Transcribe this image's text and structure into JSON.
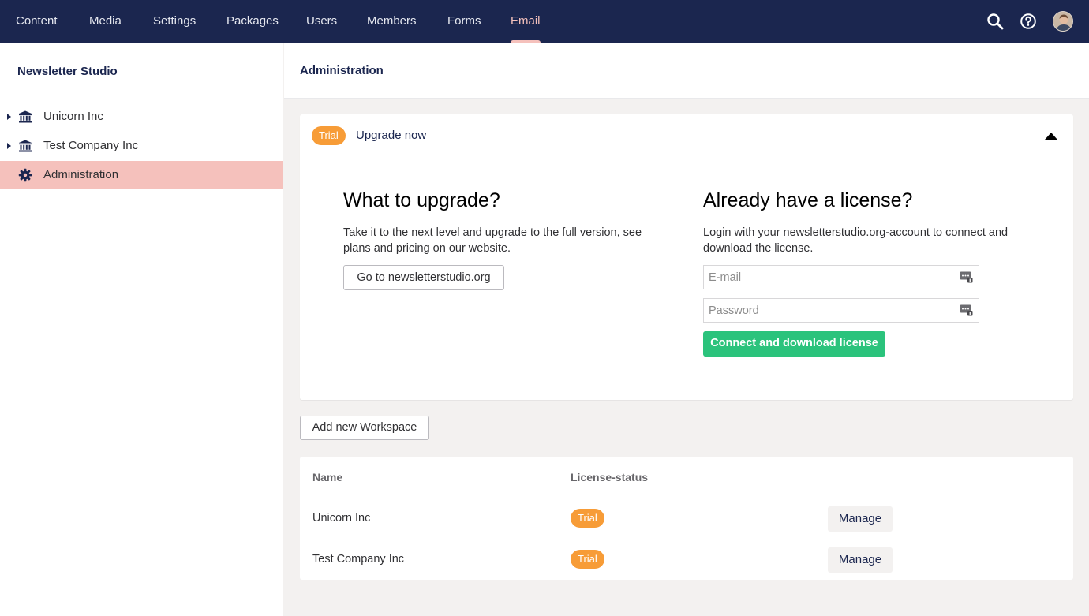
{
  "topnav": {
    "items": [
      {
        "label": "Content",
        "active": false
      },
      {
        "label": "Media",
        "active": false
      },
      {
        "label": "Settings",
        "active": false
      },
      {
        "label": "Packages",
        "active": false
      },
      {
        "label": "Users",
        "active": false
      },
      {
        "label": "Members",
        "active": false
      },
      {
        "label": "Forms",
        "active": false
      },
      {
        "label": "Email",
        "active": true
      }
    ],
    "icons": [
      "search-icon",
      "help-icon",
      "avatar"
    ]
  },
  "sidebar": {
    "title": "Newsletter Studio",
    "items": [
      {
        "label": "Unicorn Inc",
        "icon": "bank-icon",
        "expandable": true,
        "active": false
      },
      {
        "label": "Test Company Inc",
        "icon": "bank-icon",
        "expandable": true,
        "active": false
      },
      {
        "label": "Administration",
        "icon": "gear-icon",
        "expandable": false,
        "active": true
      }
    ]
  },
  "main": {
    "title": "Administration",
    "upgrade_panel": {
      "badge": "Trial",
      "label": "Upgrade now",
      "left": {
        "heading": "What to upgrade?",
        "text_line1": "Take it to the next level and upgrade to the full version, see",
        "text_line2": "plans and pricing on our website.",
        "button": "Go to newsletterstudio.org"
      },
      "right": {
        "heading": "Already have a license?",
        "text_line1": "Login with your newsletterstudio.org-account to connect and",
        "text_line2": "download the license.",
        "email_placeholder": "E-mail",
        "password_placeholder": "Password",
        "button": "Connect and download license"
      }
    },
    "add_workspace_button": "Add new Workspace",
    "table": {
      "headers": [
        "Name",
        "License-status"
      ],
      "rows": [
        {
          "name": "Unicorn Inc",
          "status": "Trial",
          "action": "Manage"
        },
        {
          "name": "Test Company Inc",
          "status": "Trial",
          "action": "Manage"
        }
      ]
    }
  },
  "colors": {
    "nav_bg": "#1b264f",
    "accent_pink": "#f5c1bc",
    "trial_orange": "#f79c37",
    "green": "#2bc37c"
  }
}
